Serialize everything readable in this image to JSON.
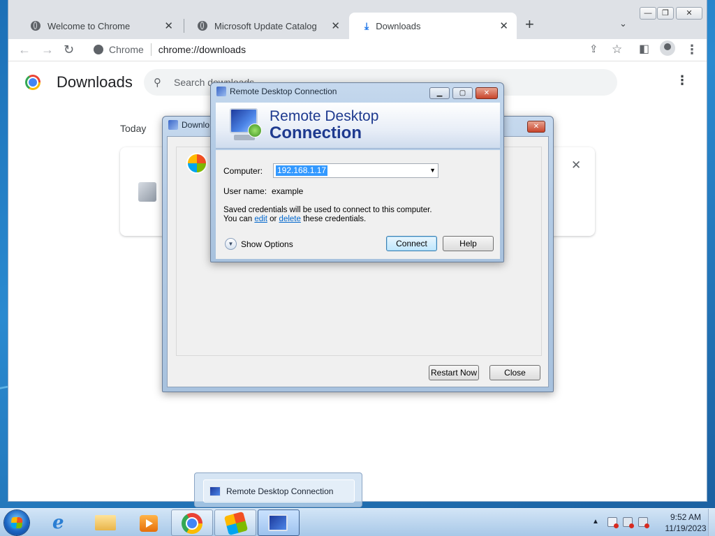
{
  "chrome": {
    "tabs": [
      {
        "title": "Welcome to Chrome"
      },
      {
        "title": "Microsoft Update Catalog"
      },
      {
        "title": "Downloads"
      }
    ],
    "omnibox": {
      "site": "Chrome",
      "url": "chrome://downloads"
    },
    "downloads_page": {
      "title": "Downloads",
      "search_placeholder": "Search downloads",
      "group_label": "Today"
    }
  },
  "update_dialog": {
    "title": "Downlo",
    "buttons": {
      "restart": "Restart Now",
      "close": "Close"
    }
  },
  "rdp_dialog": {
    "window_title": "Remote Desktop Connection",
    "banner": {
      "line1": "Remote Desktop",
      "line2": "Connection"
    },
    "computer_label": "Computer:",
    "computer_value": "192.168.1.17",
    "username_label": "User name:",
    "username_value": "example",
    "note_line1": "Saved credentials will be used to connect to this computer.",
    "note_prefix": "You can",
    "note_edit": "edit",
    "note_or": "or",
    "note_delete": "delete",
    "note_suffix": "these credentials.",
    "show_options": "Show Options",
    "connect": "Connect",
    "help": "Help"
  },
  "taskbar": {
    "thumbnail_title": "Remote Desktop Connection",
    "time": "9:52 AM",
    "date": "11/19/2023"
  },
  "icons": {
    "window_controls": [
      "minimize-icon",
      "maximize-icon",
      "close-icon"
    ]
  }
}
